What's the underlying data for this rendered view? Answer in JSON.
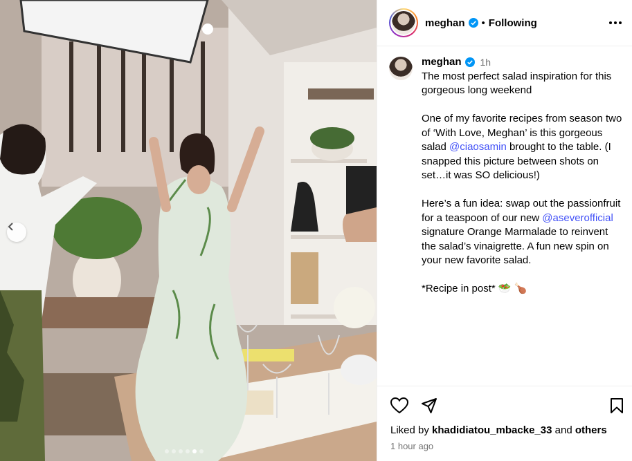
{
  "header": {
    "username": "meghan",
    "separator": "•",
    "following_label": "Following"
  },
  "caption": {
    "username": "meghan",
    "time": "1h",
    "paragraphs": [
      "The most perfect salad inspiration for this gorgeous long weekend",
      "One of my favorite recipes from season two of ‘With Love, Meghan’ is this gorgeous salad",
      "brought to the table. (I snapped this picture between shots on set…it was SO delicious!)",
      "Here’s a fun idea: swap out the passionfruit for a teaspoon of our new",
      "signature Orange Marmalade to reinvent the salad’s vinaigrette. A fun new spin on your new favorite salad.",
      "*Recipe in post*"
    ],
    "mention1": "@ciaosamin",
    "mention2": "@aseverofficial",
    "emoji": "🥗 🍗"
  },
  "likes": {
    "prefix": "Liked by",
    "user": "khadidiatou_mbacke_33",
    "and": "and",
    "others": "others"
  },
  "timestamp": "1 hour ago",
  "carousel": {
    "count": 6,
    "active_index": 4
  },
  "icons": [
    "more-icon",
    "verified-icon",
    "heart-icon",
    "share-icon",
    "bookmark-icon",
    "chevron-left-icon"
  ]
}
